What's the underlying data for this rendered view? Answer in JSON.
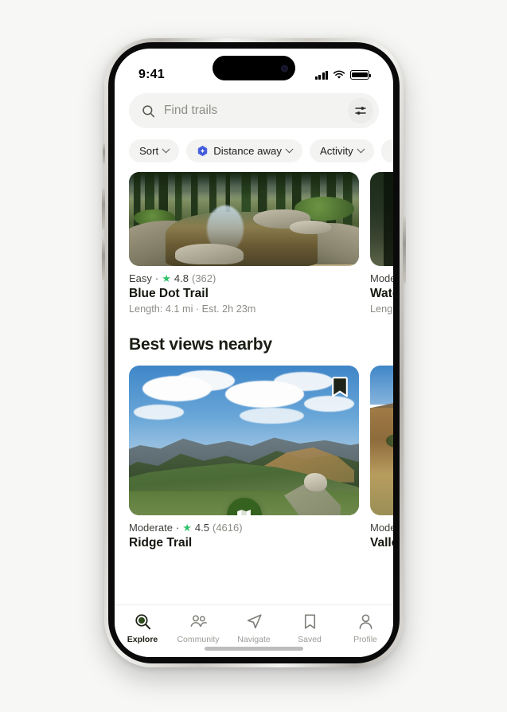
{
  "device": {
    "status_bar": {
      "clock": "9:41",
      "signal_icon": "cellular-signal-icon",
      "wifi_icon": "wifi-icon",
      "battery_icon": "battery-full-icon"
    }
  },
  "search": {
    "placeholder": "Find trails",
    "value": "",
    "search_icon": "search-icon",
    "filter_icon": "sliders-filter-icon"
  },
  "filters": {
    "chips": [
      {
        "label": "Sort",
        "icon": null,
        "has_caret": true
      },
      {
        "label": "Distance away",
        "icon": "hexagon-location-icon",
        "has_caret": true
      },
      {
        "label": "Activity",
        "icon": null,
        "has_caret": true
      },
      {
        "label": "",
        "icon": null,
        "has_caret": false
      }
    ]
  },
  "sections": [
    {
      "title": "",
      "cards": [
        {
          "difficulty": "Easy",
          "separator": "·",
          "star_icon": "star-icon",
          "rating": "4.8",
          "review_count": "(362)",
          "name": "Blue Dot Trail",
          "details": "Length: 4.1 mi · Est. 2h 23m",
          "scene": "creek"
        },
        {
          "difficulty": "Moder",
          "separator": "",
          "star_icon": "",
          "rating": "",
          "review_count": "",
          "name": "Wate",
          "details": "Lengt",
          "scene": "dark-forest"
        }
      ]
    },
    {
      "title": "Best views nearby",
      "cards": [
        {
          "difficulty": "Moderate",
          "separator": "·",
          "star_icon": "star-icon",
          "rating": "4.5",
          "review_count": "(4616)",
          "name": "Ridge Trail",
          "details": "",
          "scene": "ridge",
          "bookmark_icon": "bookmark-icon"
        },
        {
          "difficulty": "Moder",
          "separator": "",
          "star_icon": "",
          "rating": "",
          "review_count": "",
          "name": "Valle",
          "details": "",
          "scene": "golden-hillside"
        }
      ]
    }
  ],
  "map_button": {
    "icon": "map-icon",
    "color": "#35621f"
  },
  "tabbar": {
    "items": [
      {
        "label": "Explore",
        "icon": "explore-search-icon",
        "active": true
      },
      {
        "label": "Community",
        "icon": "people-icon",
        "active": false
      },
      {
        "label": "Navigate",
        "icon": "navigation-arrow-icon",
        "active": false
      },
      {
        "label": "Saved",
        "icon": "bookmark-icon",
        "active": false
      },
      {
        "label": "Profile",
        "icon": "person-icon",
        "active": false
      }
    ]
  },
  "colors": {
    "accent_green": "#35621f",
    "star_green": "#2fc26a",
    "chip_bg": "#f3f3f1",
    "page_bg": "#f7f7f5",
    "text_primary": "#14170f",
    "text_secondary": "#8b8d86",
    "hex_blue": "#4a63e0"
  }
}
